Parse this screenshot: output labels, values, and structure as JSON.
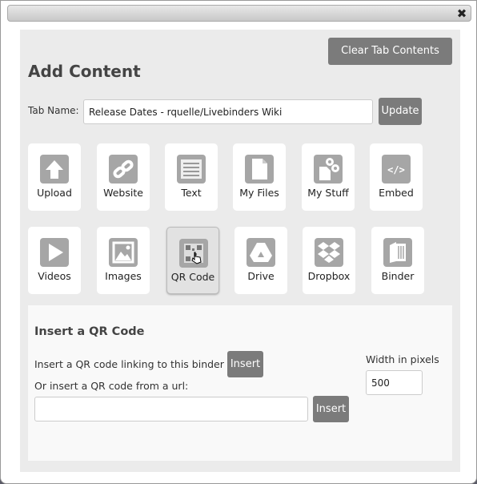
{
  "dialog": {
    "close_icon": "close-icon"
  },
  "header": {
    "clear_label": "Clear Tab Contents",
    "title": "Add Content"
  },
  "tab_name": {
    "label": "Tab Name:",
    "value": "Release Dates - rquelle/Livebinders Wiki",
    "update_label": "Update"
  },
  "tiles": [
    {
      "label": "Upload",
      "icon": "upload-icon"
    },
    {
      "label": "Website",
      "icon": "link-icon"
    },
    {
      "label": "Text",
      "icon": "text-icon"
    },
    {
      "label": "My Files",
      "icon": "file-icon"
    },
    {
      "label": "My Stuff",
      "icon": "file-link-icon"
    },
    {
      "label": "Embed",
      "icon": "code-icon"
    },
    {
      "label": "Videos",
      "icon": "play-icon"
    },
    {
      "label": "Images",
      "icon": "image-icon"
    },
    {
      "label": "QR Code",
      "icon": "qr-code-icon",
      "selected": true
    },
    {
      "label": "Drive",
      "icon": "google-drive-icon"
    },
    {
      "label": "Dropbox",
      "icon": "dropbox-icon"
    },
    {
      "label": "Binder",
      "icon": "binder-icon"
    }
  ],
  "qr": {
    "title": "Insert a QR Code",
    "link_text": "Insert a QR code linking to this binder",
    "insert_label": "Insert",
    "url_text": "Or insert a QR code from a url:",
    "url_value": "",
    "url_insert_label": "Insert",
    "width_label": "Width in pixels",
    "width_value": "500"
  }
}
